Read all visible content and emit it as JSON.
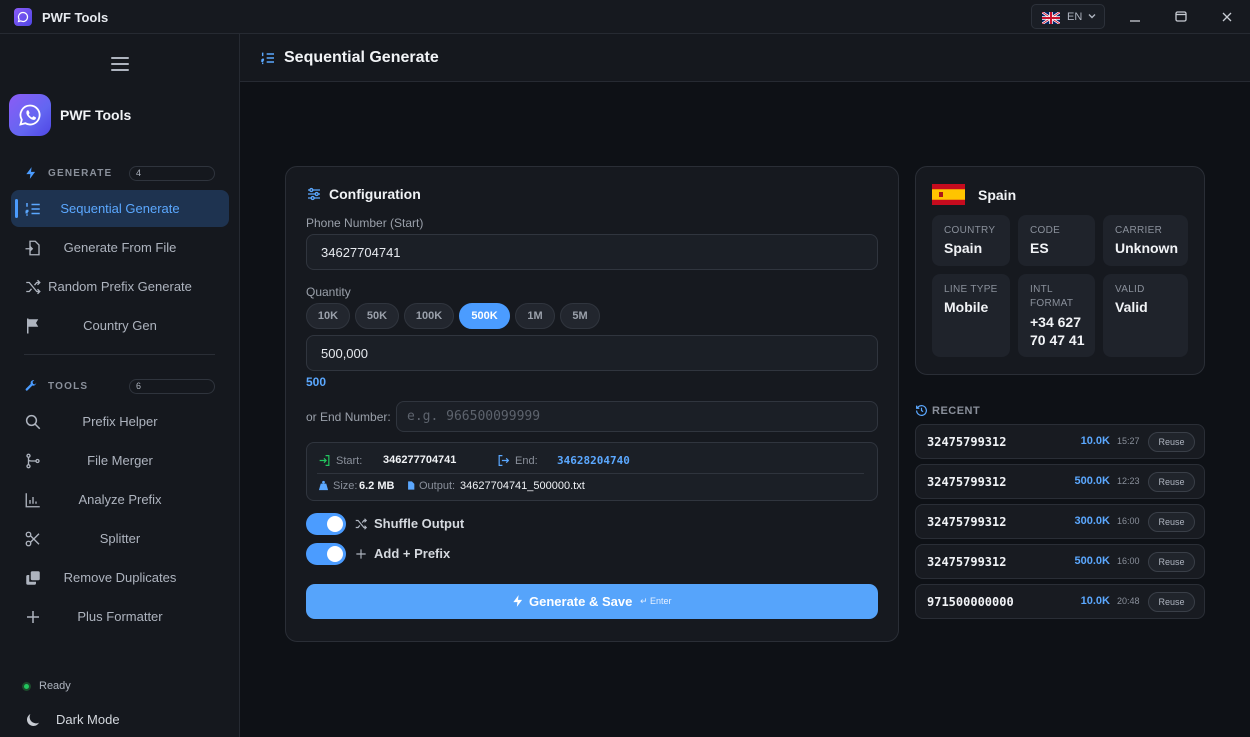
{
  "window": {
    "title": "PWF Tools",
    "language": "EN"
  },
  "sidebar": {
    "brand": "PWF Tools",
    "generate_section": {
      "label": "GENERATE",
      "count": "4"
    },
    "generate_items": [
      {
        "label": "Sequential Generate",
        "icon": "list-ordered-icon",
        "active": true
      },
      {
        "label": "Generate From File",
        "icon": "file-import-icon"
      },
      {
        "label": "Random Prefix Generate",
        "icon": "shuffle-icon"
      },
      {
        "label": "Country Gen",
        "icon": "flag-icon"
      }
    ],
    "tools_section": {
      "label": "TOOLS",
      "count": "6"
    },
    "tools_items": [
      {
        "label": "Prefix Helper",
        "icon": "search-icon"
      },
      {
        "label": "File Merger",
        "icon": "branch-merge-icon"
      },
      {
        "label": "Analyze Prefix",
        "icon": "bar-chart-icon"
      },
      {
        "label": "Splitter",
        "icon": "scissors-icon"
      },
      {
        "label": "Remove Duplicates",
        "icon": "copy-icon"
      },
      {
        "label": "Plus Formatter",
        "icon": "plus-icon"
      }
    ],
    "status": "Ready",
    "dark_mode_label": "Dark Mode"
  },
  "page": {
    "title": "Sequential Generate"
  },
  "config": {
    "title": "Configuration",
    "phone_label": "Phone Number (Start)",
    "phone_value": "34627704741",
    "quantity_label": "Quantity",
    "quantity_options": [
      "10K",
      "50K",
      "100K",
      "500K",
      "1M",
      "5M"
    ],
    "quantity_selected": "500K",
    "quantity_value": "500,000",
    "quantity_hint": "500",
    "end_label": "or End Number:",
    "end_placeholder": "e.g. 966500099999",
    "summary": {
      "start_label": "Start:",
      "start_value": "346277704741",
      "end_label": "End:",
      "end_value": "34628204740",
      "size_label": "Size:",
      "size_value": "6.2 MB",
      "output_label": "Output:",
      "output_value": "34627704741_500000.txt"
    },
    "shuffle_label": "Shuffle Output",
    "shuffle_on": true,
    "add_prefix_label": "Add + Prefix",
    "add_prefix_on": true,
    "generate_label": "Generate & Save",
    "generate_hint": "↵ Enter"
  },
  "country": {
    "name": "Spain",
    "tiles": [
      {
        "label": "COUNTRY",
        "value": "Spain"
      },
      {
        "label": "CODE",
        "value": "ES"
      },
      {
        "label": "CARRIER",
        "value": "Unknown"
      },
      {
        "label": "LINE TYPE",
        "value": "Mobile"
      },
      {
        "label": "INTL FORMAT",
        "value": "+34 627 70 47 41"
      },
      {
        "label": "VALID",
        "value": "Valid"
      }
    ]
  },
  "recent": {
    "label": "RECENT",
    "reuse_label": "Reuse",
    "items": [
      {
        "number": "32475799312",
        "qty": "10.0K",
        "time": "15:27"
      },
      {
        "number": "32475799312",
        "qty": "500.0K",
        "time": "12:23"
      },
      {
        "number": "32475799312",
        "qty": "300.0K",
        "time": "16:00"
      },
      {
        "number": "32475799312",
        "qty": "500.0K",
        "time": "16:00"
      },
      {
        "number": "971500000000",
        "qty": "10.0K",
        "time": "20:48"
      }
    ]
  },
  "colors": {
    "accent": "#4b9cff",
    "active_bg": "#1e3350",
    "status_green": "#22c55e",
    "brand_purple": "#8b5cf6"
  }
}
